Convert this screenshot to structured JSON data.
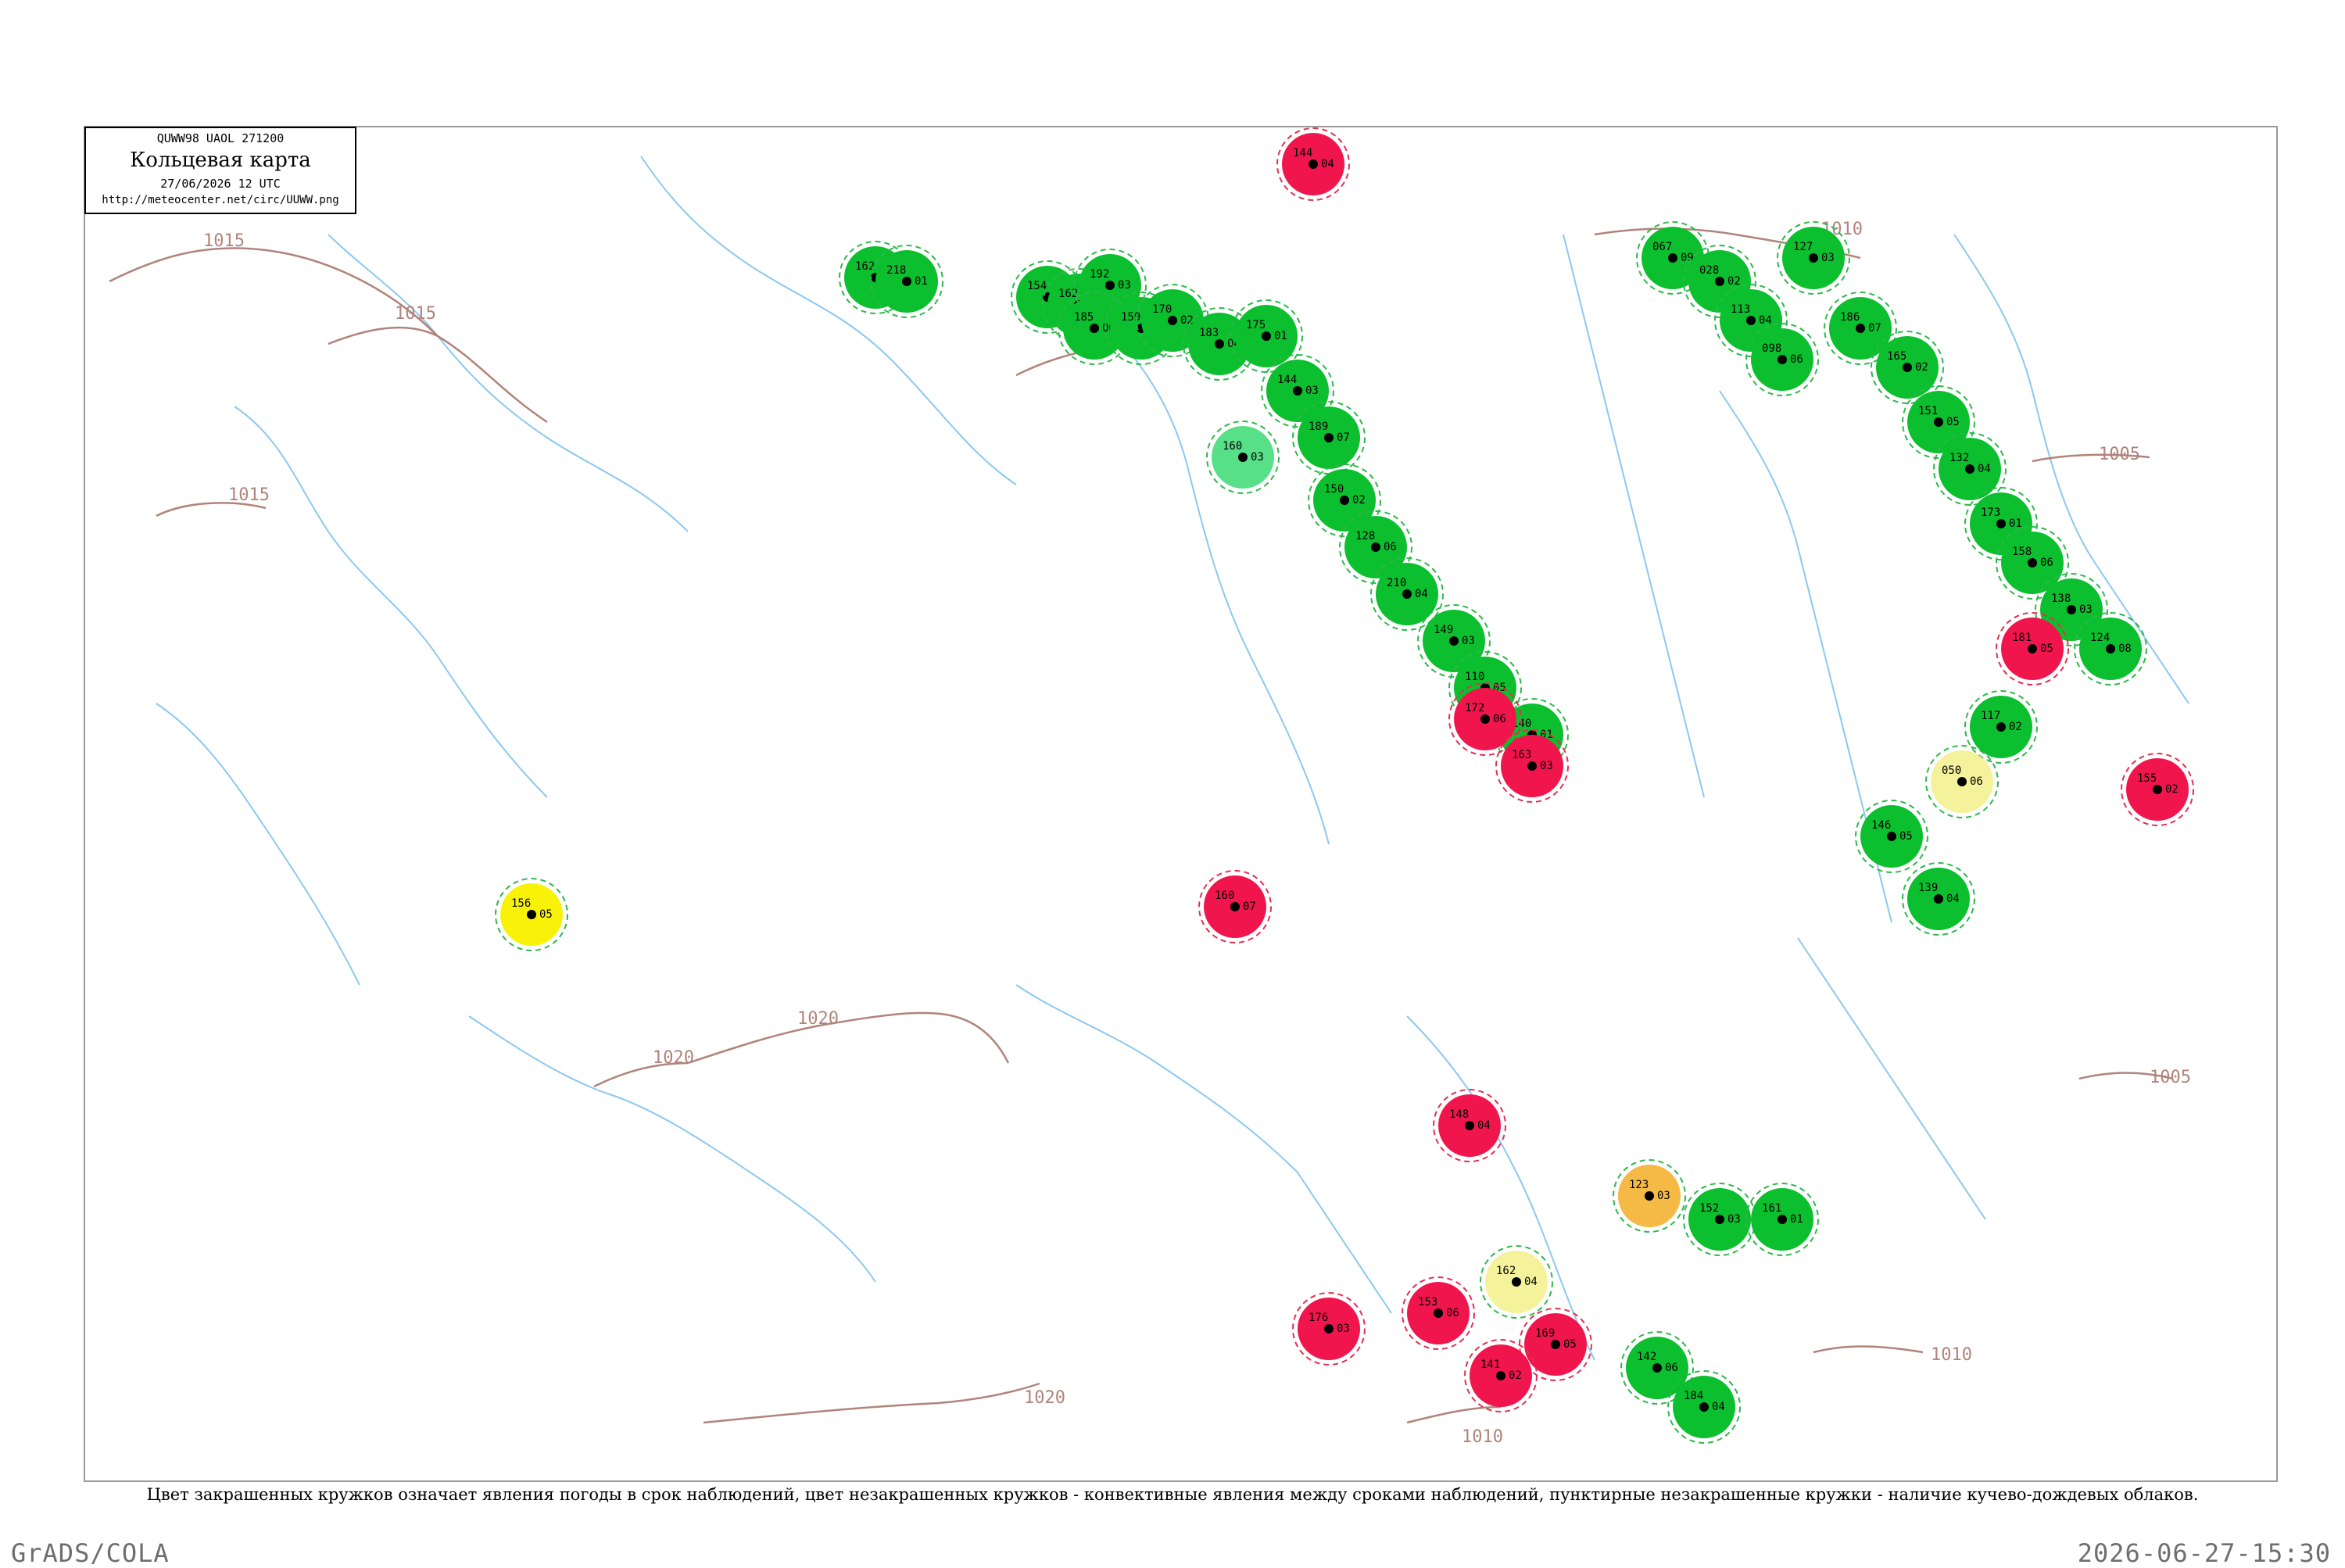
{
  "title_box": {
    "code": "QUWW98 UAOL 271200",
    "name": "Кольцевая карта",
    "date": "27/06/2026 12 UTC",
    "url": "http://meteocenter.net/circ/UUWW.png"
  },
  "isobars": [
    {
      "label": "1015"
    },
    {
      "label": "1015"
    },
    {
      "label": "1015"
    },
    {
      "label": "1015"
    },
    {
      "label": "1020"
    },
    {
      "label": "1020"
    },
    {
      "label": "1020"
    },
    {
      "label": "1010"
    },
    {
      "label": "1010"
    },
    {
      "label": "1010"
    },
    {
      "label": "1005"
    },
    {
      "label": "1005"
    }
  ],
  "stations": [
    {
      "t": "162",
      "p": "07",
      "c": "green"
    },
    {
      "t": "218",
      "p": "01",
      "c": "green"
    },
    {
      "t": "154",
      "p": "02",
      "c": "green"
    },
    {
      "t": "162",
      "p": "04",
      "c": "green"
    },
    {
      "t": "192",
      "p": "03",
      "c": "green"
    },
    {
      "t": "185",
      "p": "06",
      "c": "green"
    },
    {
      "t": "159",
      "p": "05",
      "c": "green"
    },
    {
      "t": "170",
      "p": "02",
      "c": "green"
    },
    {
      "t": "183",
      "p": "04",
      "c": "green"
    },
    {
      "t": "175",
      "p": "01",
      "c": "green"
    },
    {
      "t": "144",
      "p": "03",
      "c": "green"
    },
    {
      "t": "189",
      "p": "07",
      "c": "green"
    },
    {
      "t": "150",
      "p": "02",
      "c": "green"
    },
    {
      "t": "128",
      "p": "06",
      "c": "green"
    },
    {
      "t": "210",
      "p": "04",
      "c": "green"
    },
    {
      "t": "149",
      "p": "03",
      "c": "green"
    },
    {
      "t": "110",
      "p": "05",
      "c": "green"
    },
    {
      "t": "140",
      "p": "01",
      "c": "green"
    },
    {
      "t": "067",
      "p": "09",
      "c": "green"
    },
    {
      "t": "028",
      "p": "02",
      "c": "green"
    },
    {
      "t": "113",
      "p": "04",
      "c": "green"
    },
    {
      "t": "098",
      "p": "06",
      "c": "green"
    },
    {
      "t": "127",
      "p": "03",
      "c": "green"
    },
    {
      "t": "186",
      "p": "07",
      "c": "green"
    },
    {
      "t": "165",
      "p": "02",
      "c": "green"
    },
    {
      "t": "151",
      "p": "05",
      "c": "green"
    },
    {
      "t": "132",
      "p": "04",
      "c": "green"
    },
    {
      "t": "173",
      "p": "01",
      "c": "green"
    },
    {
      "t": "158",
      "p": "06",
      "c": "green"
    },
    {
      "t": "138",
      "p": "03",
      "c": "green"
    },
    {
      "t": "124",
      "p": "08",
      "c": "green"
    },
    {
      "t": "117",
      "p": "02",
      "c": "green"
    },
    {
      "t": "146",
      "p": "05",
      "c": "green"
    },
    {
      "t": "139",
      "p": "04",
      "c": "green"
    },
    {
      "t": "152",
      "p": "03",
      "c": "green"
    },
    {
      "t": "161",
      "p": "01",
      "c": "green"
    },
    {
      "t": "142",
      "p": "06",
      "c": "green"
    },
    {
      "t": "184",
      "p": "04",
      "c": "green"
    },
    {
      "t": "144",
      "p": "04",
      "c": "red"
    },
    {
      "t": "172",
      "p": "06",
      "c": "red"
    },
    {
      "t": "163",
      "p": "03",
      "c": "red"
    },
    {
      "t": "181",
      "p": "05",
      "c": "red"
    },
    {
      "t": "155",
      "p": "02",
      "c": "red"
    },
    {
      "t": "160",
      "p": "07",
      "c": "red"
    },
    {
      "t": "148",
      "p": "04",
      "c": "red"
    },
    {
      "t": "176",
      "p": "03",
      "c": "red"
    },
    {
      "t": "153",
      "p": "06",
      "c": "red"
    },
    {
      "t": "169",
      "p": "05",
      "c": "red"
    },
    {
      "t": "141",
      "p": "02",
      "c": "red"
    },
    {
      "t": "156",
      "p": "05",
      "c": "yellow"
    },
    {
      "t": "050",
      "p": "06",
      "c": "yellow"
    },
    {
      "t": "162",
      "p": "04",
      "c": "yellow"
    },
    {
      "t": "123",
      "p": "03",
      "c": "orange"
    },
    {
      "t": "160",
      "p": "03",
      "c": "mint"
    }
  ],
  "colors": {
    "green": "#0cbf2e",
    "red": "#f0164d",
    "yellow": "#f7f208",
    "orange": "#f5b946",
    "mint": "#57e087",
    "pale": "#f5f29c",
    "isobar": "#b0847a",
    "river": "#8cc8f0",
    "dash_green": "#2db84a",
    "dash_red": "#e03050",
    "frame": "#9a9a9a"
  },
  "caption": "Цвет закрашенных кружков означает явления погоды в срок наблюдений, цвет незакрашенных кружков - конвективные явления между сроками наблюдений, пунктирные незакрашенные кружки - наличие кучево-дождевых облаков.",
  "footer": {
    "left": "GrADS/COLA",
    "right": "2026-06-27-15:30"
  }
}
